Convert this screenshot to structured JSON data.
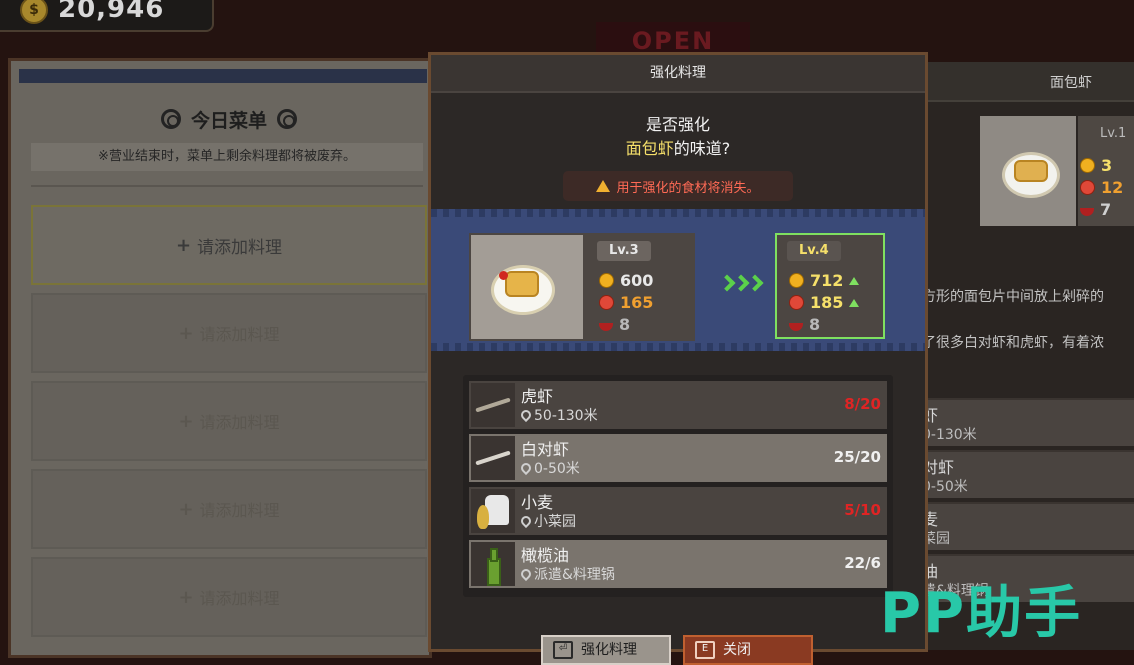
{
  "hud": {
    "coins": "20,946",
    "coin_icon": "$"
  },
  "background_sign": "OPEN",
  "menu": {
    "title": "今日菜单",
    "note": "※营业结束时，菜单上剩余料理都将被废弃。",
    "slot_label": "请添加料理",
    "slots": [
      "请添加料理",
      "请添加料理",
      "请添加料理",
      "请添加料理",
      "请添加料理"
    ]
  },
  "detail": {
    "title": "面包虾",
    "lv": "Lv.1",
    "stats": [
      "3",
      "12",
      "7"
    ],
    "desc": [
      "方形的面包片中间放上剁碎的",
      "了很多白对虾和虎虾，有着浓"
    ],
    "ingredients": [
      {
        "name": "虾",
        "src": "0-130米"
      },
      {
        "name": "对虾",
        "src": "0-50米"
      },
      {
        "name": "麦",
        "src": "菜园"
      },
      {
        "name": "油",
        "src": "遣&料理锅"
      }
    ]
  },
  "modal": {
    "title": "强化料理",
    "question_line1": "是否强化",
    "dish_name": "面包虾",
    "question_suffix": "的味道?",
    "warning": "用于强化的食材将消失。",
    "current": {
      "lv": "Lv.3",
      "price": "600",
      "taste": "165",
      "count": "8"
    },
    "next": {
      "lv": "Lv.4",
      "price": "712",
      "taste": "185",
      "count": "8"
    },
    "ingredients": [
      {
        "name": "虎虾",
        "source": "50-130米",
        "count": "8/20",
        "enough": false
      },
      {
        "name": "白对虾",
        "source": "0-50米",
        "count": "25/20",
        "enough": true
      },
      {
        "name": "小麦",
        "source": "小菜园",
        "count": "5/10",
        "enough": false
      },
      {
        "name": "橄榄油",
        "source": "派遣&料理锅",
        "count": "22/6",
        "enough": true
      }
    ],
    "confirm_button": "强化料理",
    "close_button": "关闭",
    "confirm_key": "⏎",
    "close_key": "E"
  },
  "watermark": "PP助手",
  "colors": {
    "highlight": "#f6e06a",
    "warning": "#ff6a55",
    "upgrade_green": "#7fe060",
    "shortage_red": "#e02424",
    "price": "#f6e06a",
    "taste": "#f0a030"
  }
}
